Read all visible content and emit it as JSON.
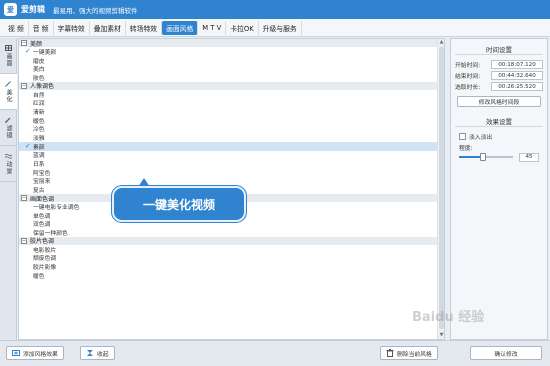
{
  "app": {
    "logo_text": "爱",
    "name": "爱剪辑",
    "slogan": "最易用、强大的视频剪辑软件"
  },
  "tabs": [
    {
      "label": "视  频",
      "active": false
    },
    {
      "label": "音  频",
      "active": false
    },
    {
      "label": "字幕特效",
      "active": false
    },
    {
      "label": "叠加素材",
      "active": false
    },
    {
      "label": "转场特效",
      "active": false
    },
    {
      "label": "画面风格",
      "active": true
    },
    {
      "label": "M T V",
      "active": false
    },
    {
      "label": "卡拉OK",
      "active": false
    },
    {
      "label": "升级与服务",
      "active": false
    }
  ],
  "side_tabs": [
    {
      "label": "画面",
      "icon": "grid-icon",
      "active": false
    },
    {
      "label": "美化",
      "icon": "magic-wand-icon",
      "active": true
    },
    {
      "label": "滤镜",
      "icon": "brush-icon",
      "active": false
    },
    {
      "label": "动景",
      "icon": "wave-icon",
      "active": false
    }
  ],
  "effect_groups": [
    {
      "title": "美颜",
      "items": [
        {
          "label": "一键美颜",
          "checked": true
        },
        {
          "label": "磨皮"
        },
        {
          "label": "美白"
        },
        {
          "label": "肤色"
        }
      ]
    },
    {
      "title": "人像调色",
      "items": [
        {
          "label": "自然"
        },
        {
          "label": "红润"
        },
        {
          "label": "清新"
        },
        {
          "label": "暖色"
        },
        {
          "label": "冷色"
        },
        {
          "label": "淡雅"
        },
        {
          "label": "素颜",
          "checked": true,
          "selected": true
        },
        {
          "label": "蓝调"
        },
        {
          "label": "日系"
        },
        {
          "label": "阿宝色"
        },
        {
          "label": "宝丽来"
        },
        {
          "label": "复古"
        }
      ]
    },
    {
      "title": "画面色调",
      "items": [
        {
          "label": "一键电影专业调色"
        },
        {
          "label": "单色调"
        },
        {
          "label": "双色调"
        },
        {
          "label": "保留一种颜色"
        }
      ]
    },
    {
      "title": "胶片色调",
      "items": [
        {
          "label": "电影胶片"
        },
        {
          "label": "颓废色调"
        },
        {
          "label": "胶片影像"
        },
        {
          "label": "暖色"
        }
      ]
    }
  ],
  "callout": {
    "text": "一键美化视频"
  },
  "time_settings": {
    "title": "时间设置",
    "start_label": "开始时间:",
    "start_value": "00:18:07.120",
    "end_label": "结束时间:",
    "end_value": "00:44:32.640",
    "duration_label": "选取时长:",
    "duration_value": "00:26:25.520",
    "modify_button": "修改风格时间段"
  },
  "effect_settings": {
    "title": "效果设置",
    "fade_label": "淡入淡出",
    "fade_checked": false,
    "degree_label": "程度:",
    "degree_value": "45",
    "degree_fraction": 0.45
  },
  "bottom": {
    "add_button": "添加风格效果",
    "collapse_button": "收起",
    "delete_button": "删除当前风格",
    "confirm_button": "确认修改"
  },
  "watermark": "Baidu 经验"
}
